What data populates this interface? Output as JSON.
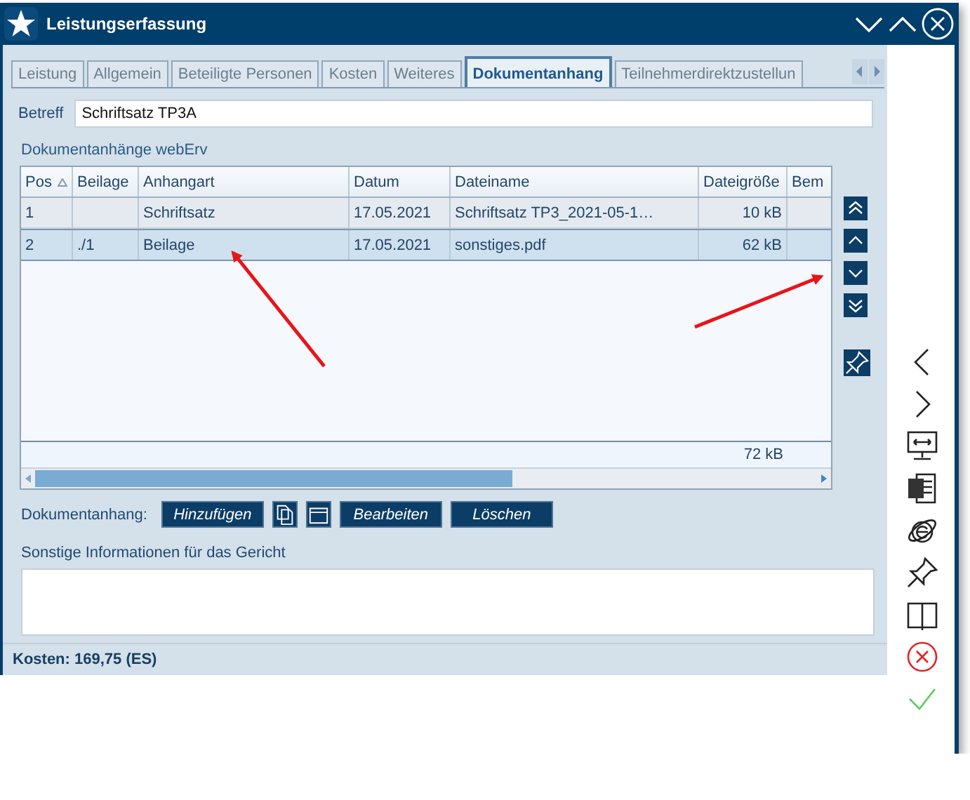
{
  "window": {
    "title": "Leistungserfassung"
  },
  "tabs": [
    {
      "label": "Leistung",
      "selected": false
    },
    {
      "label": "Allgemein",
      "selected": false
    },
    {
      "label": "Beteiligte Personen",
      "selected": false
    },
    {
      "label": "Kosten",
      "selected": false
    },
    {
      "label": "Weiteres",
      "selected": false
    },
    {
      "label": "Dokumentanhang",
      "selected": true
    },
    {
      "label": "Teilnehmerdirektzustellun",
      "selected": false
    }
  ],
  "betreff": {
    "label": "Betreff",
    "value": "Schriftsatz TP3A"
  },
  "attachments": {
    "title": "Dokumentanhänge webErv",
    "table": {
      "columns": [
        {
          "label": "Pos",
          "sorted": true
        },
        {
          "label": "Beilage",
          "sorted": false
        },
        {
          "label": "Anhangart",
          "sorted": false
        },
        {
          "label": "Datum",
          "sorted": false
        },
        {
          "label": "Dateiname",
          "sorted": false
        },
        {
          "label": "Dateigröße",
          "sorted": false
        },
        {
          "label": "Bem",
          "sorted": false
        }
      ],
      "rows": [
        {
          "selected": false,
          "cells": [
            "1",
            "",
            "Schriftsatz",
            "17.05.2021",
            "Schriftsatz TP3_2021-05-1…",
            "10 kB",
            ""
          ]
        },
        {
          "selected": true,
          "cells": [
            "2",
            "./1",
            "Beilage",
            "17.05.2021",
            "sonstiges.pdf",
            "62 kB",
            ""
          ]
        }
      ],
      "total": "72 kB"
    }
  },
  "actions": {
    "label": "Dokumentanhang:",
    "buttons": [
      {
        "kind": "text",
        "label": "Hinzufügen"
      },
      {
        "kind": "copy"
      },
      {
        "kind": "folder"
      },
      {
        "kind": "text",
        "label": "Bearbeiten"
      },
      {
        "kind": "text",
        "label": "Löschen"
      }
    ]
  },
  "notes": {
    "label": "Sonstige Informationen für das Gericht"
  },
  "status_bar": {
    "text": "Kosten: 169,75 (ES)"
  }
}
